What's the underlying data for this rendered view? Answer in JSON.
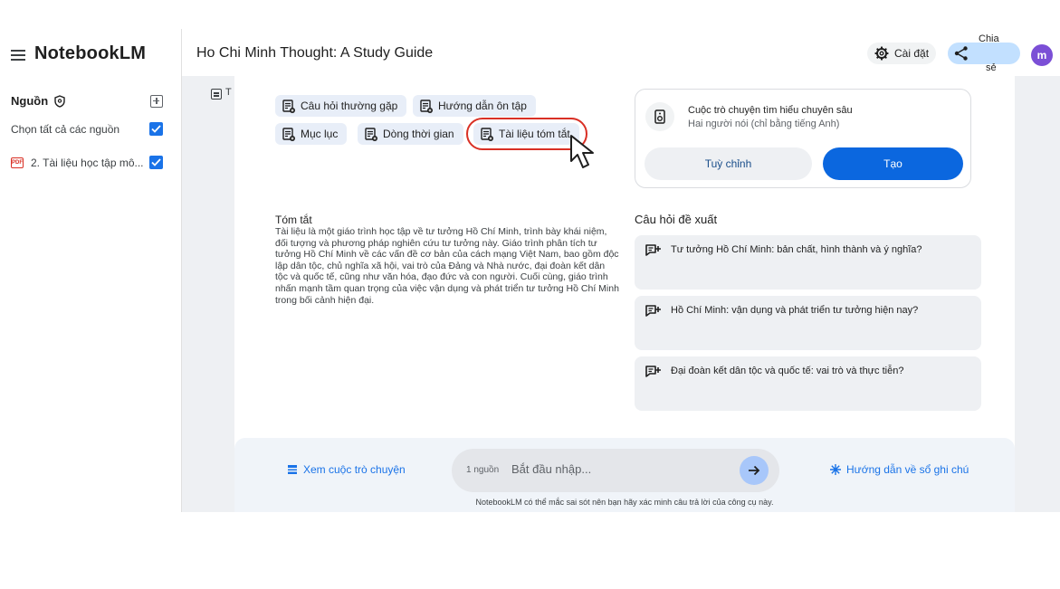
{
  "app": {
    "brand": "NotebookLM"
  },
  "header": {
    "notebook_title": "Ho Chi Minh Thought: A Study Guide",
    "settings_label": "Cài đặt",
    "share_label_line1": "Chia",
    "share_label_line2": "sẻ",
    "avatar_initial": "m"
  },
  "sidebar": {
    "sources_title": "Nguồn",
    "select_all_label": "Chọn tất cả các nguồn",
    "select_all_checked": true,
    "sources": [
      {
        "label": "2. Tài liệu học tập mô...",
        "type": "PDF",
        "checked": true
      }
    ]
  },
  "notes": {
    "title_initial": "T"
  },
  "chips": [
    "Câu hỏi thường gặp",
    "Hướng dẫn ôn tập",
    "Mục lục",
    "Dòng thời gian",
    "Tài liệu tóm tắt"
  ],
  "audio": {
    "title": "Cuộc trò chuyện tìm hiểu chuyên sâu",
    "subtitle": "Hai người nói (chỉ bằng tiếng Anh)",
    "customize_label": "Tuỳ chỉnh",
    "create_label": "Tạo"
  },
  "summary": {
    "title": "Tóm tắt",
    "text": "Tài liệu là một giáo trình học tập về tư tưởng Hồ Chí Minh, trình bày khái niệm, đối tượng và phương pháp nghiên cứu tư tưởng này. Giáo trình phân tích tư tưởng Hồ Chí Minh về các vấn đề cơ bản của cách mạng Việt Nam, bao gồm độc lập dân tộc, chủ nghĩa xã hội, vai trò của Đảng và Nhà nước, đại đoàn kết dân tộc và quốc tế, cũng như văn hóa, đạo đức và con người. Cuối cùng, giáo trình nhấn mạnh tầm quan trọng của việc vận dụng và phát triển tư tưởng Hồ Chí Minh trong bối cảnh hiện đại."
  },
  "suggestions": {
    "title": "Câu hỏi đề xuất",
    "items": [
      "Tư tưởng Hồ Chí Minh: bản chất, hình thành và ý nghĩa?",
      "Hồ Chí Minh: vận dụng và phát triển tư tưởng hiện nay?",
      "Đại đoàn kết dân tộc và quốc tế: vai trò và thực tiễn?"
    ]
  },
  "chat": {
    "view_chat_label": "Xem cuộc trò chuyện",
    "source_count": "1 nguồn",
    "placeholder": "Bắt đầu nhập...",
    "guide_label": "Hướng dẫn về sổ ghi chú",
    "disclaimer": "NotebookLM có thể mắc sai sót nên bạn hãy xác minh câu trả lời của công cụ này."
  },
  "colors": {
    "accent": "#1a73e8",
    "create_button": "#0b67df",
    "highlight": "#d93025",
    "share_bg": "#c2e0ff",
    "avatar_bg": "#7b4fd6"
  }
}
